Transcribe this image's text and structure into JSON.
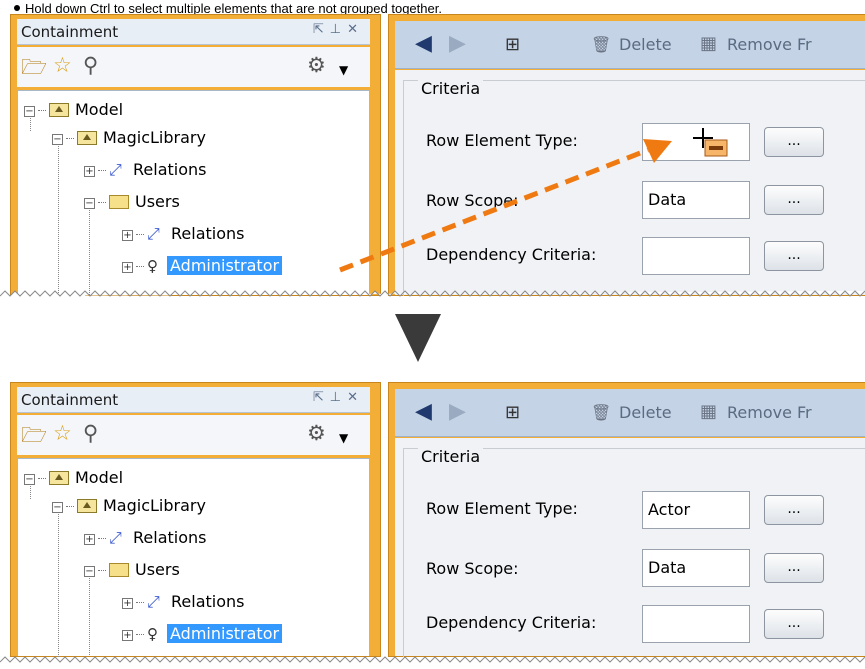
{
  "note": "Hold down Ctrl to select multiple elements that are not grouped together.",
  "colors": {
    "panel_border": "#f3ae38",
    "drag_arrow": "#f07a12",
    "selection": "#3399ff"
  },
  "before": {
    "containment": {
      "title": "Containment",
      "header_icons": [
        "undock-icon",
        "pin-icon",
        "close-icon"
      ],
      "toolbar_icons": [
        "open-folder-icon",
        "star-icon",
        "search-icon",
        "gear-icon",
        "dropdown-icon"
      ],
      "tree": [
        {
          "label": "Model",
          "icon": "package-icon"
        },
        {
          "label": "MagicLibrary",
          "icon": "package-icon"
        },
        {
          "label": "Relations",
          "icon": "relation-icon"
        },
        {
          "label": "Users",
          "icon": "folder-icon"
        },
        {
          "label": "Relations",
          "icon": "relation-icon"
        },
        {
          "label": "Administrator",
          "icon": "actor-icon",
          "selected": true
        }
      ]
    },
    "toolbar": {
      "delete": "Delete",
      "remove": "Remove Fr"
    },
    "criteria": {
      "title": "Criteria",
      "fields": [
        {
          "label": "Row Element Type:",
          "value": "",
          "button": "..."
        },
        {
          "label": "Row Scope:",
          "value": "Data",
          "button": "..."
        },
        {
          "label": "Dependency Criteria:",
          "value": "",
          "button": "..."
        }
      ]
    }
  },
  "after": {
    "containment": {
      "title": "Containment",
      "tree": [
        {
          "label": "Model",
          "icon": "package-icon"
        },
        {
          "label": "MagicLibrary",
          "icon": "package-icon"
        },
        {
          "label": "Relations",
          "icon": "relation-icon"
        },
        {
          "label": "Users",
          "icon": "folder-icon"
        },
        {
          "label": "Relations",
          "icon": "relation-icon"
        },
        {
          "label": "Administrator",
          "icon": "actor-icon",
          "selected": true
        }
      ]
    },
    "toolbar": {
      "delete": "Delete",
      "remove": "Remove Fr"
    },
    "criteria": {
      "title": "Criteria",
      "fields": [
        {
          "label": "Row Element Type:",
          "value": "Actor",
          "button": "..."
        },
        {
          "label": "Row Scope:",
          "value": "Data",
          "button": "..."
        },
        {
          "label": "Dependency Criteria:",
          "value": "",
          "button": "..."
        }
      ]
    }
  }
}
